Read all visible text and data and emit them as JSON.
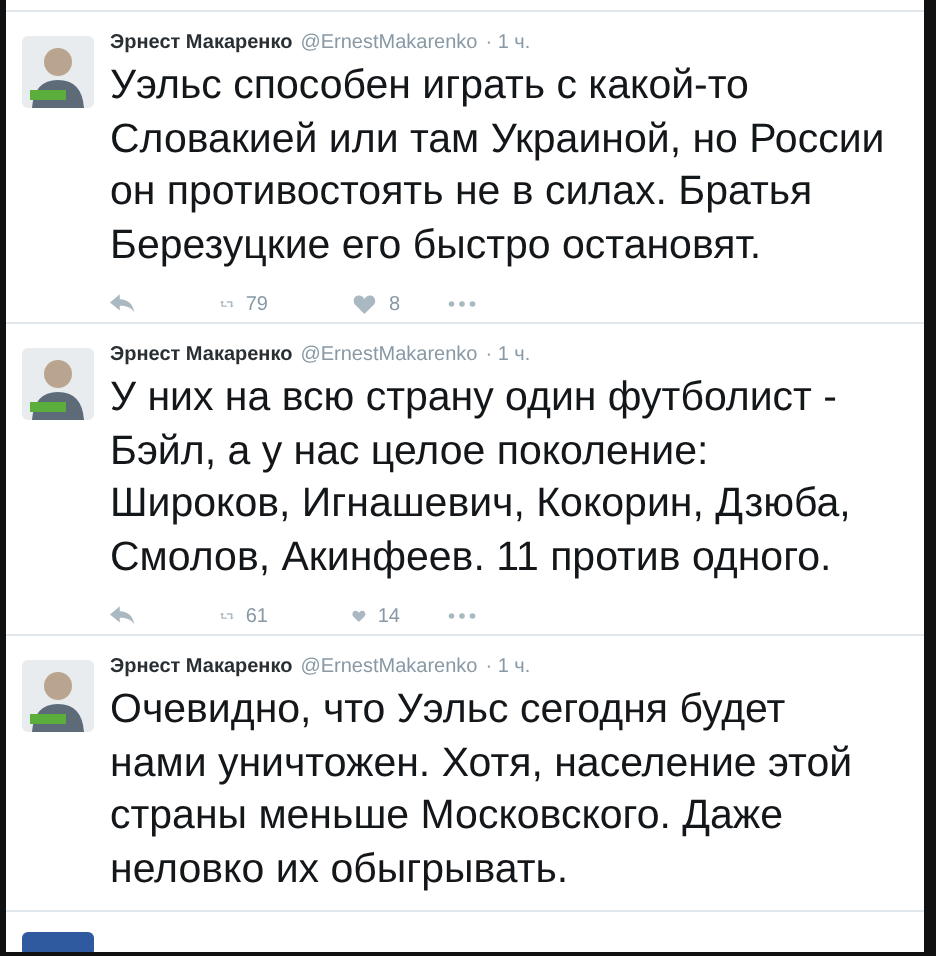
{
  "tweets": [
    {
      "author": "Эрнест Макаренко",
      "handle": "@ErnestMakarenko",
      "time": "· 1 ч.",
      "lines": [
        "Уэльс способен играть с какой-то",
        "Словакией или там Украиной, но России",
        "он противостоять не в силах. Братья",
        "Березуцкие его быстро остановят."
      ],
      "retweets": "79",
      "likes": "8"
    },
    {
      "author": "Эрнест Макаренко",
      "handle": "@ErnestMakarenko",
      "time": "· 1 ч.",
      "lines": [
        "У них на всю страну один футболист -",
        "Бэйл, а у нас целое поколение:",
        "Широков, Игнашевич, Кокорин, Дзюба,",
        "Смолов, Акинфеев. 11 против одного."
      ],
      "retweets": "61",
      "likes": "14"
    },
    {
      "author": "Эрнест Макаренко",
      "handle": "@ErnestMakarenko",
      "time": "· 1 ч.",
      "lines": [
        "Очевидно, что Уэльс сегодня будет",
        "нами уничтожен. Хотя, население этой",
        "страны меньше Московского. Даже",
        "неловко их обыгрывать."
      ]
    }
  ]
}
